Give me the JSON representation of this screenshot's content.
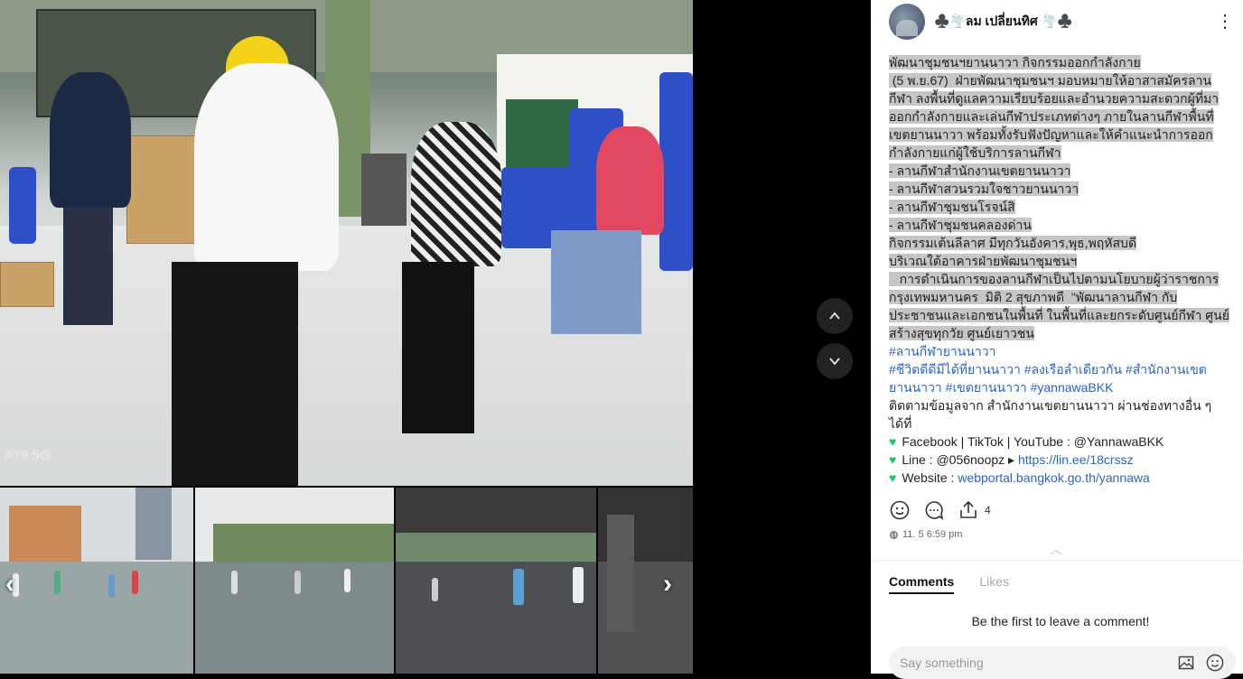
{
  "author": {
    "name": "♣️🌪️ลม เปลี่ยนทิศ 🌪️♣️"
  },
  "media": {
    "watermark": "A79 5G"
  },
  "post": {
    "lines": [
      "พัฒนาชุมชนฯยานนาวา กิจกรรมออกกำลังกาย",
      " (5 พ.ย.67)  ฝ่ายพัฒนาชุมชนฯ มอบหมายให้อาสาสมัครลาน",
      "กีฬา ลงพื้นที่ดูแลความเรียบร้อยและอำนวยความสะดวกผู้ที่มา",
      "ออกกำลังกายและเล่นกีฬาประเภทต่างๆ ภายในลานกีฬาพื้นที่",
      "เขตยานนาวา พร้อมทั้งรับฟังปัญหาและให้คำแนะนำการออก",
      "กำลังกายแก่ผู้ใช้บริการลานกีฬา",
      "- ลานกีฬาสำนักงานเขตยานนาวา",
      "- ลานกีฬาสวนรวมใจชาวยานนาวา",
      "- ลานกีฬาชุมชนโรจน์สิ",
      "- ลานกีฬาชุมชนคลองด่าน",
      "กิจกรรมเต้นลีลาศ มีทุกวันอังคาร,พุธ,พฤหัสบดี",
      "บริเวณใต้อาคารฝ่ายพัฒนาชุมชนฯ",
      "   การดำเนินการของลานกีฬาเป็นไปตามนโยบายผู้ว่าราชการ",
      "กรุงเทพมหานคร  มิติ 2 สุขภาพดี  \"พัฒนาลานกีฬา กับ",
      "ประชาชนและเอกชนในพื้นที่ ในพื้นที่และยกระดับศูนย์กีฬา ศูนย์",
      "สร้างสุขทุกวัย ศูนย์เยาวชน"
    ],
    "hashtags_1": "#ลานกีฬายานนาวา",
    "hashtags_2": "#ชีวิตดีดีมีได้ที่ยานนาวา #ลงเรือลำเดียวกัน #สำนักงานเขต",
    "hashtags_3": "ยานนาวา #เขตยานนาวา #yannawaBKK",
    "follow": "ติดตามข้อมูลจาก สำนักงานเขตยานนาวา ผ่านช่องทางอื่น ๆ ได้ที่",
    "social_1": "Facebook | TikTok | YouTube : @YannawaBKK",
    "social_2_prefix": "Line : @056noopz ▸ ",
    "social_2_link": "https://lin.ee/18crssz",
    "social_3_prefix": "Website : ",
    "social_3_link": "webportal.bangkok.go.th/yannawa"
  },
  "actions": {
    "share_count": "4"
  },
  "timestamp": "11. 5 6:59 pm",
  "tabs": {
    "comments": "Comments",
    "likes": "Likes"
  },
  "comments": {
    "empty": "Be the first to leave a comment!",
    "placeholder": "Say something"
  },
  "colors": {
    "accent": "#2b63c8",
    "heart": "#18c96a",
    "highlight": "#c6c6c6"
  }
}
